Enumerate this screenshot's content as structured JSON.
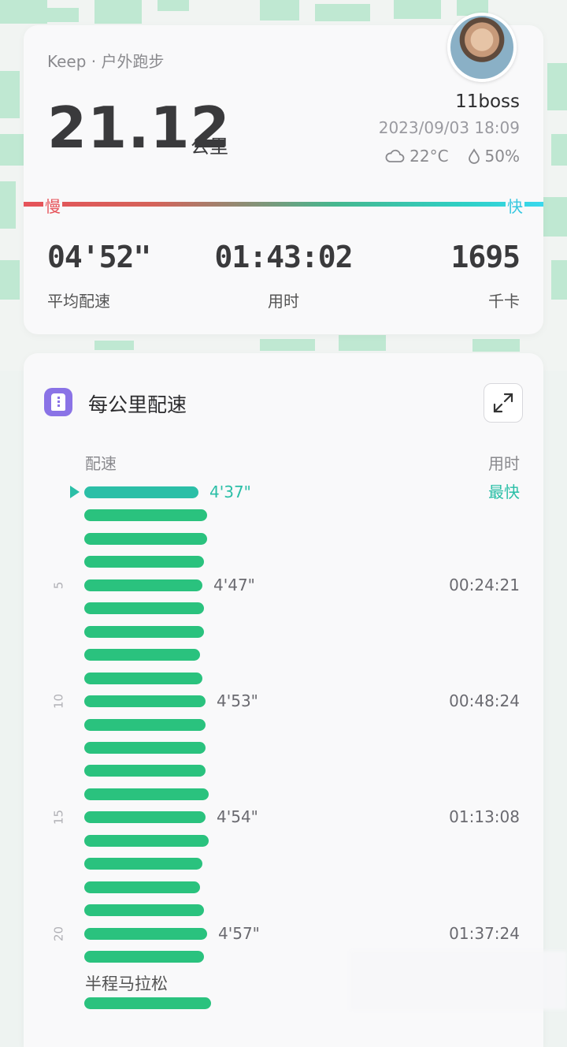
{
  "summary": {
    "source": "Keep · 户外跑步",
    "distance": "21.12",
    "distance_unit": "公里",
    "username": "11boss",
    "datetime": "2023/09/03 18:09",
    "temperature": "22°C",
    "humidity": "50%",
    "pace_scale": {
      "slow": "慢",
      "fast": "快"
    },
    "stats": [
      {
        "value": "04'52\"",
        "label": "平均配速"
      },
      {
        "value": "01:43:02",
        "label": "用时"
      },
      {
        "value": "1695",
        "label": "千卡"
      }
    ]
  },
  "splits": {
    "title": "每公里配速",
    "col_pace": "配速",
    "col_time": "用时",
    "half_marathon_label": "半程马拉松",
    "rows": [
      {
        "fill": 0.66,
        "pace": "4'37\"",
        "time": "最快",
        "best": true
      },
      {
        "fill": 0.71
      },
      {
        "fill": 0.71
      },
      {
        "fill": 0.69
      },
      {
        "fill": 0.68,
        "pace": "4'47\"",
        "time": "00:24:21",
        "km": "5"
      },
      {
        "fill": 0.69
      },
      {
        "fill": 0.69
      },
      {
        "fill": 0.67
      },
      {
        "fill": 0.68
      },
      {
        "fill": 0.7,
        "pace": "4'53\"",
        "time": "00:48:24",
        "km": "10"
      },
      {
        "fill": 0.7
      },
      {
        "fill": 0.7
      },
      {
        "fill": 0.7
      },
      {
        "fill": 0.72
      },
      {
        "fill": 0.7,
        "pace": "4'54\"",
        "time": "01:13:08",
        "km": "15"
      },
      {
        "fill": 0.72
      },
      {
        "fill": 0.68
      },
      {
        "fill": 0.67
      },
      {
        "fill": 0.69
      },
      {
        "fill": 0.71,
        "pace": "4'57\"",
        "time": "01:37:24",
        "km": "20"
      },
      {
        "fill": 0.69
      },
      {
        "fill": 0.73
      }
    ]
  },
  "colors": {
    "bar": "#2ac27e",
    "best": "#2bbfa7",
    "slow": "#e6535a",
    "fast": "#3ad8ee",
    "icon_bg": "#8a73e6"
  },
  "icons": [
    "cloud-icon",
    "droplet-icon",
    "expand-icon",
    "pace-icon",
    "triangle-marker-icon"
  ]
}
